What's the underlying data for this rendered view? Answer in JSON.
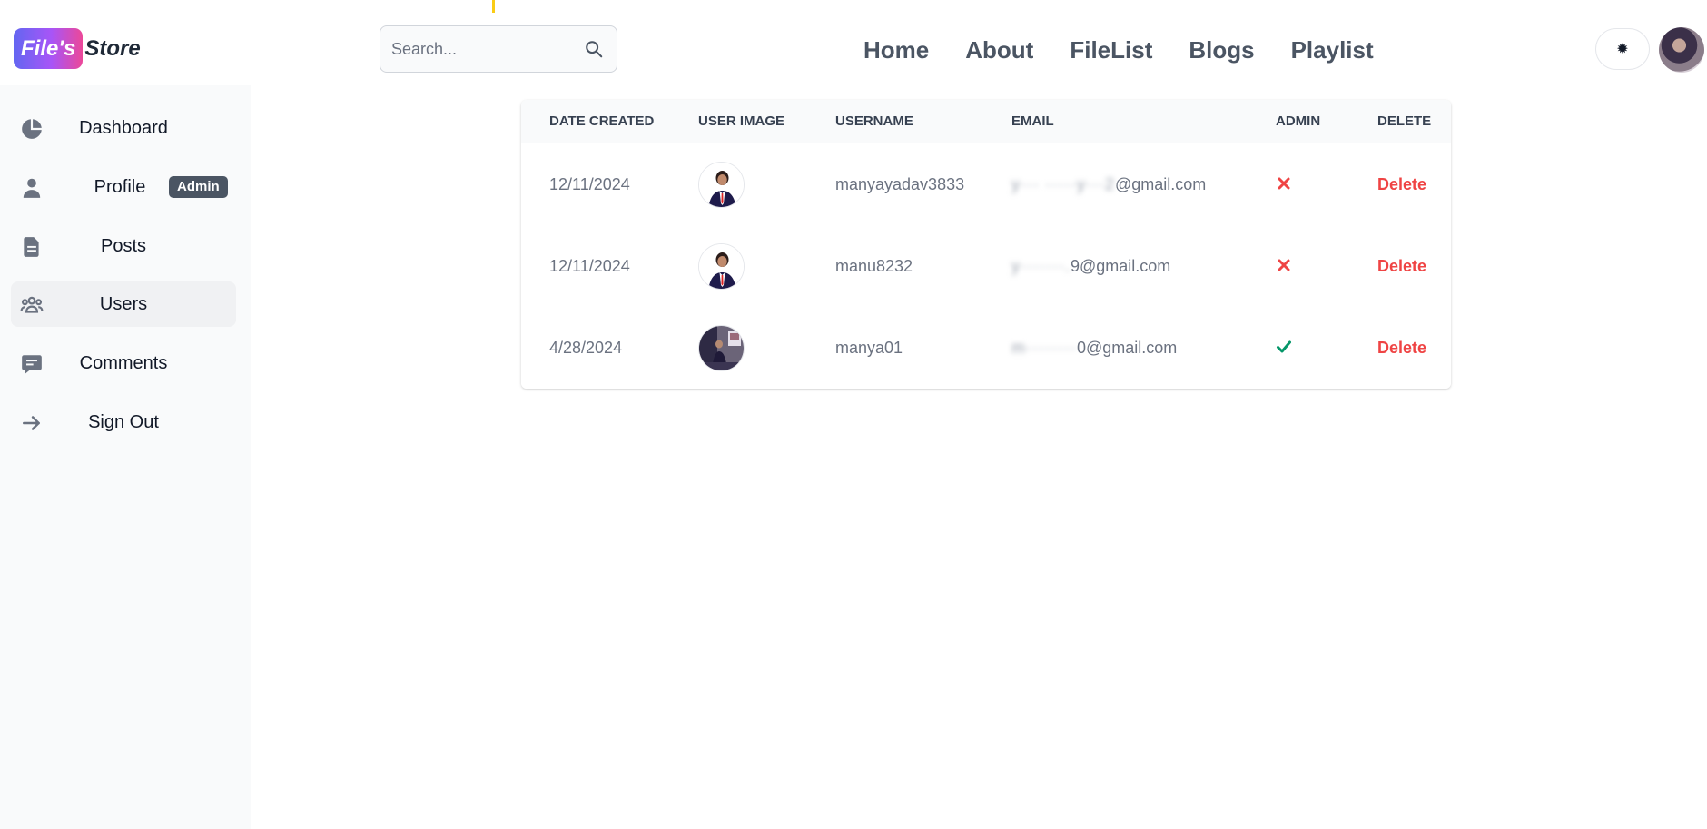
{
  "brand": {
    "badge": "File's",
    "text": "Store"
  },
  "search": {
    "placeholder": "Search..."
  },
  "nav": {
    "items": [
      "Home",
      "About",
      "FileList",
      "Blogs",
      "Playlist"
    ]
  },
  "header": {
    "theme_toggle_glyph": "✹"
  },
  "sidebar": {
    "items": [
      {
        "label": "Dashboard",
        "icon": "pie-chart-icon"
      },
      {
        "label": "Profile",
        "icon": "user-icon",
        "badge": "Admin"
      },
      {
        "label": "Posts",
        "icon": "document-icon"
      },
      {
        "label": "Users",
        "icon": "users-group-icon",
        "active": true
      },
      {
        "label": "Comments",
        "icon": "comment-icon"
      },
      {
        "label": "Sign Out",
        "icon": "arrow-right-icon"
      }
    ]
  },
  "table": {
    "headers": [
      "Date created",
      "User image",
      "Username",
      "Email",
      "Admin",
      "Delete"
    ],
    "rows": [
      {
        "date": "12/11/2024",
        "username": "manyayadav3833",
        "email_hidden": "y··· ·····y···2",
        "email_domain": "@gmail.com",
        "admin": false,
        "delete_label": "Delete"
      },
      {
        "date": "12/11/2024",
        "username": "manu8232",
        "email_hidden": "y·······.",
        "email_domain": "9@gmail.com",
        "admin": false,
        "delete_label": "Delete"
      },
      {
        "date": "4/28/2024",
        "username": "manya01",
        "email_hidden": "m········",
        "email_domain": "0@gmail.com",
        "admin": true,
        "delete_label": "Delete"
      }
    ]
  },
  "colors": {
    "accent": "#ef4444",
    "admin_true": "#059669",
    "admin_false": "#ef4444",
    "brand_gradient_start": "#6366f1",
    "brand_gradient_end": "#ec4899"
  }
}
